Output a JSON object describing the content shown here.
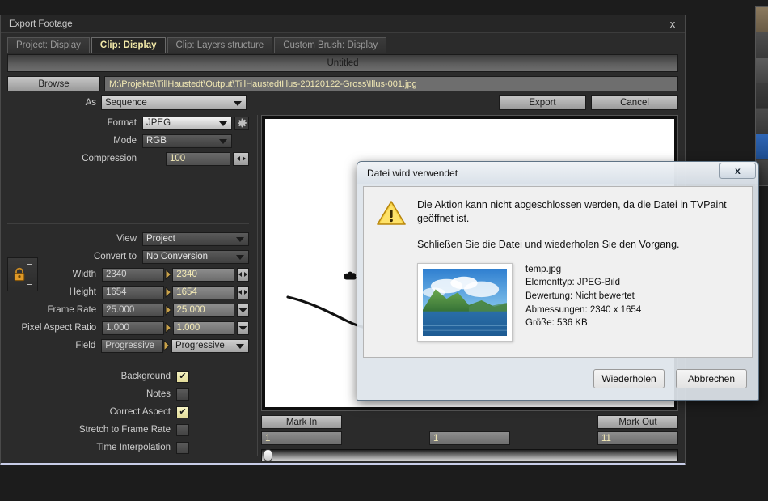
{
  "window": {
    "title": "Export Footage",
    "close_icon": "close-icon",
    "untitled_label": "Untitled"
  },
  "tabs": [
    {
      "label": "Project: Display",
      "active": false
    },
    {
      "label": "Clip: Display",
      "active": true
    },
    {
      "label": "Clip: Layers structure",
      "active": false
    },
    {
      "label": "Custom Brush: Display",
      "active": false
    }
  ],
  "path_row": {
    "browse_label": "Browse",
    "path_value": "M:\\Projekte\\TillHaustedt\\Output\\TillHaustedtIllus-20120122-Gross\\Illus-001.jpg"
  },
  "as_row": {
    "label": "As",
    "value": "Sequence",
    "export_label": "Export",
    "cancel_label": "Cancel"
  },
  "format_section": {
    "format_label": "Format",
    "format_value": "JPEG",
    "gear_icon": "gear-icon",
    "mode_label": "Mode",
    "mode_value": "RGB",
    "compression_label": "Compression",
    "compression_value": "100"
  },
  "video_section": {
    "view_label": "View",
    "view_value": "Project",
    "convert_label": "Convert to",
    "convert_value": "No Conversion",
    "lock_icon": "lock-icon",
    "rows": [
      {
        "label": "Width",
        "source": "2340",
        "target": "2340",
        "control": "spinner"
      },
      {
        "label": "Height",
        "source": "1654",
        "target": "1654",
        "control": "spinner"
      },
      {
        "label": "Frame Rate",
        "source": "25.000",
        "target": "25.000",
        "control": "dropdown"
      },
      {
        "label": "Pixel Aspect Ratio",
        "source": "1.000",
        "target": "1.000",
        "control": "dropdown"
      },
      {
        "label": "Field",
        "source": "Progressive",
        "target": "Progressive",
        "control": "inline-dropdown"
      }
    ]
  },
  "checkboxes": [
    {
      "label": "Background",
      "checked": true
    },
    {
      "label": "Notes",
      "checked": false
    },
    {
      "label": "Correct Aspect",
      "checked": true
    },
    {
      "label": "Stretch to Frame Rate",
      "checked": false
    },
    {
      "label": "Time Interpolation",
      "checked": false
    }
  ],
  "timeline": {
    "mark_in_label": "Mark In",
    "mark_out_label": "Mark Out",
    "mark_in_value": "1",
    "current_value": "1",
    "mark_out_value": "11"
  },
  "dialog": {
    "title": "Datei wird verwendet",
    "close_label": "x",
    "warning_icon": "warning-triangle-icon",
    "line1": "Die Aktion kann nicht abgeschlossen werden, da die Datei in TVPaint geöffnet ist.",
    "line2": "Schließen Sie die Datei und wiederholen Sie den Vorgang.",
    "file": {
      "name": "temp.jpg",
      "type": "Elementtyp: JPEG-Bild",
      "rating": "Bewertung: Nicht bewertet",
      "dimensions": "Abmessungen: 2340 x 1654",
      "size": "Größe: 536 KB"
    },
    "retry_label": "Wiederholen",
    "cancel_label": "Abbrechen"
  },
  "colors": {
    "window_bg": "#2b2b2b",
    "desktop_bg": "#1c1c1c",
    "accent_text": "#f2e9b5",
    "active_tab_text": "#f2e9a8",
    "checkbox_checked": "#f6f3c3",
    "bottom_border": "#c8cde8"
  }
}
